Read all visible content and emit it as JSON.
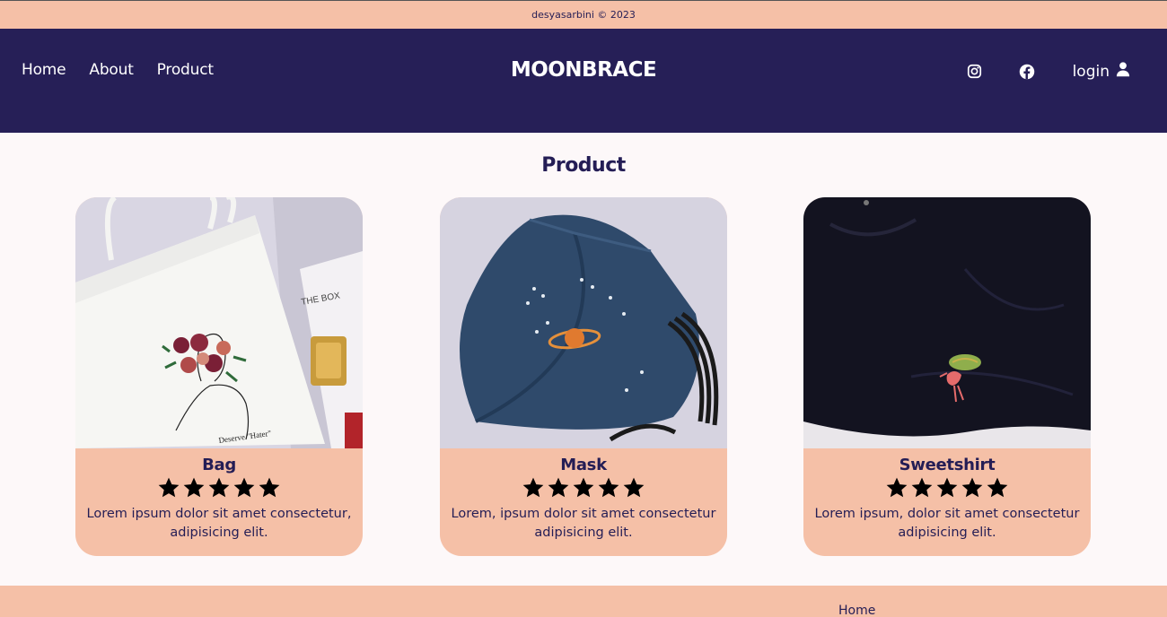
{
  "topbar": {
    "copyright": "desyasarbini © 2023"
  },
  "nav": {
    "links": [
      "Home",
      "About",
      "Product"
    ],
    "brand": "MOONBRACE",
    "login_label": "login",
    "icons": [
      "instagram-icon",
      "facebook-icon",
      "user-icon"
    ]
  },
  "section": {
    "title": "Product"
  },
  "products": [
    {
      "name": "Bag",
      "rating": 5,
      "description": "Lorem ipsum dolor sit amet consectetur, adipisicing elit."
    },
    {
      "name": "Mask",
      "rating": 5,
      "description": "Lorem, ipsum dolor sit amet consectetur adipisicing elit."
    },
    {
      "name": "Sweetshirt",
      "rating": 5,
      "description": "Lorem ipsum, dolor sit amet consectetur adipisicing elit."
    }
  ],
  "footer": {
    "link": "Home"
  },
  "colors": {
    "navy": "#261f57",
    "peach": "#f5c0a7",
    "background": "#fdf8f9"
  }
}
